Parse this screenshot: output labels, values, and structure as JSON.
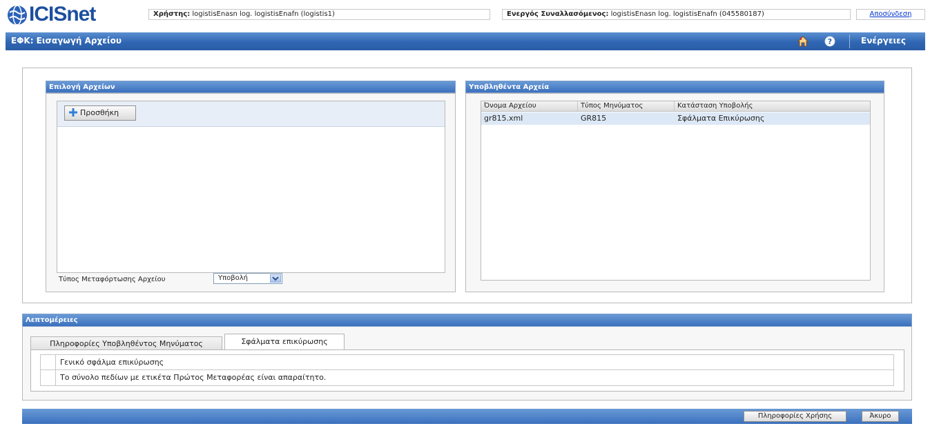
{
  "brand": {
    "name": "ICISnet"
  },
  "header": {
    "user_label": "Χρήστης:",
    "user_value": "logistisEnasn log. logistisEnafn (logistis1)",
    "active_label": "Ενεργός Συναλλασόμενος:",
    "active_value": "logistisEnasn log. logistisEnafn (045580187)",
    "logout_label": "Αποσύνδεση"
  },
  "titlebar": {
    "title": "ΕΦΚ: Εισαγωγή Αρχείου",
    "actions_label": "Ενέργειες",
    "home_icon": "home-icon",
    "help_icon": "help-icon"
  },
  "left_panel": {
    "title": "Επιλογή Αρχείων",
    "add_button_label": "Προσθήκη",
    "upload_type_label": "Τύπος Μεταφόρτωσης Αρχείου",
    "upload_type_value": "Υποβολή"
  },
  "right_panel": {
    "title": "Υποβληθέντα Αρχεία",
    "columns": [
      "Όνομα Αρχείου",
      "Τύπος Μηνύματος",
      "Κατάσταση Υποβολής"
    ],
    "rows": [
      {
        "file": "gr815.xml",
        "type": "GR815",
        "status": "Σφάλματα Επικύρωσης"
      }
    ]
  },
  "details": {
    "title": "Λεπτομέρειες",
    "tabs": [
      "Πληροφορίες Υποβληθέντος Μηνύματος",
      "Σφάλματα επικύρωσης"
    ],
    "active_tab": 1,
    "errors": [
      "Γενικό σφάλμα επικύρωσης",
      "Το σύνολο πεδίων με ετικέτα Πρώτος Μεταφορέας είναι απαραίτητο."
    ]
  },
  "footer": {
    "help_button_label": "Πληροφορίες Χρήσης",
    "cancel_button_label": "Άκυρο"
  },
  "colors": {
    "accent_blue": "#2f66b3",
    "selected_row": "#dde8f6",
    "brand_blue": "#1d4f9e"
  }
}
